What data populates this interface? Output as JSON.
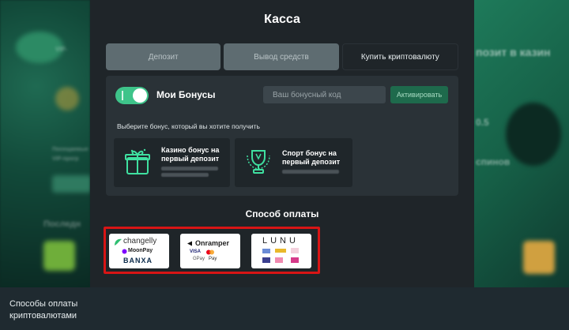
{
  "modal": {
    "title": "Касса",
    "tabs": [
      {
        "label": "Депозит",
        "active": false
      },
      {
        "label": "Вывод средств",
        "active": false
      },
      {
        "label": "Купить криптовалюту",
        "active": true
      }
    ]
  },
  "bonus": {
    "toggle_on": true,
    "label": "Мои Бонусы",
    "code_placeholder": "Ваш бонусный код",
    "activate_label": "Активировать",
    "choose_text": "Выберите бонус, который вы хотите получить",
    "cards": [
      {
        "title": "Казино бонус на первый депозит",
        "icon": "gift-icon"
      },
      {
        "title": "Спорт бонус на первый депозит",
        "icon": "trophy-icon"
      }
    ]
  },
  "payment": {
    "title": "Способ оплаты",
    "providers": [
      {
        "name": "changelly",
        "lines": [
          "changelly",
          "MoonPay",
          "BANXA"
        ]
      },
      {
        "name": "Onramper",
        "lines": [
          "Onramper",
          "VISA",
          "GPay",
          "Pay"
        ]
      },
      {
        "name": "LUNU",
        "lines": [
          "LUNU"
        ]
      }
    ]
  },
  "background": {
    "left_text": [
      "VIP-",
      "Последн",
      "Посещаемые",
      "VIP-прогр"
    ],
    "right_text": [
      "позит в казин",
      "0.5",
      "спинов"
    ]
  },
  "caption": {
    "text": "Способы оплаты криптовалютами"
  },
  "colors": {
    "accent_green": "#3ec48a",
    "highlight_red": "#d81515",
    "modal_bg": "#1f2529"
  }
}
